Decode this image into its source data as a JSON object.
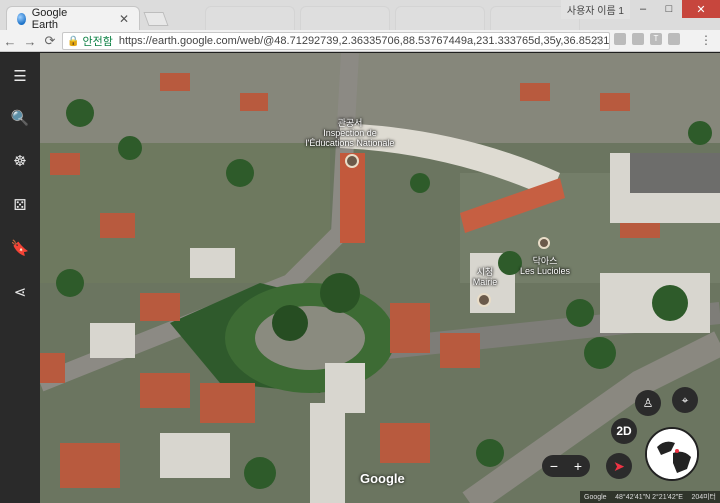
{
  "browser": {
    "active_tab_title": "Google Earth",
    "user_label": "사용자 이름 1",
    "secure_label": "안전함",
    "url": "https://earth.google.com/web/@48.71292739,2.36335706,88.53767449a,231.333765d,35y,36.85231965h,5...",
    "back": "←",
    "forward": "→",
    "reload": "⟳",
    "star": "☆",
    "menu": "⋮",
    "ext_t": "T"
  },
  "sidebar": {
    "items": [
      {
        "name": "menu-icon",
        "glyph": "☰"
      },
      {
        "name": "search-icon",
        "glyph": "🔍"
      },
      {
        "name": "voyager-icon",
        "glyph": "☸"
      },
      {
        "name": "feeling-lucky-icon",
        "glyph": "⚄"
      },
      {
        "name": "bookmark-icon",
        "glyph": "🔖"
      },
      {
        "name": "share-icon",
        "glyph": "⋖"
      }
    ]
  },
  "map": {
    "labels": [
      {
        "key": "inspection",
        "korean": "관공서",
        "text": "Inspection de l'Éducations Nationale"
      },
      {
        "key": "mairie",
        "korean": "시청",
        "text": "Mairie"
      },
      {
        "key": "lucioles",
        "korean": "닥아스",
        "text": "Les Lucioles"
      }
    ],
    "google_logo": "Google",
    "status_left": "Google",
    "coords": "48°42'41\"N 2°21'42\"E",
    "altitude": "204미터",
    "view_mode": "2D",
    "zoom_minus": "−",
    "zoom_plus": "+"
  },
  "colors": {
    "accent_green": "#0b8043",
    "dark_ui": "#2b2b2b"
  }
}
